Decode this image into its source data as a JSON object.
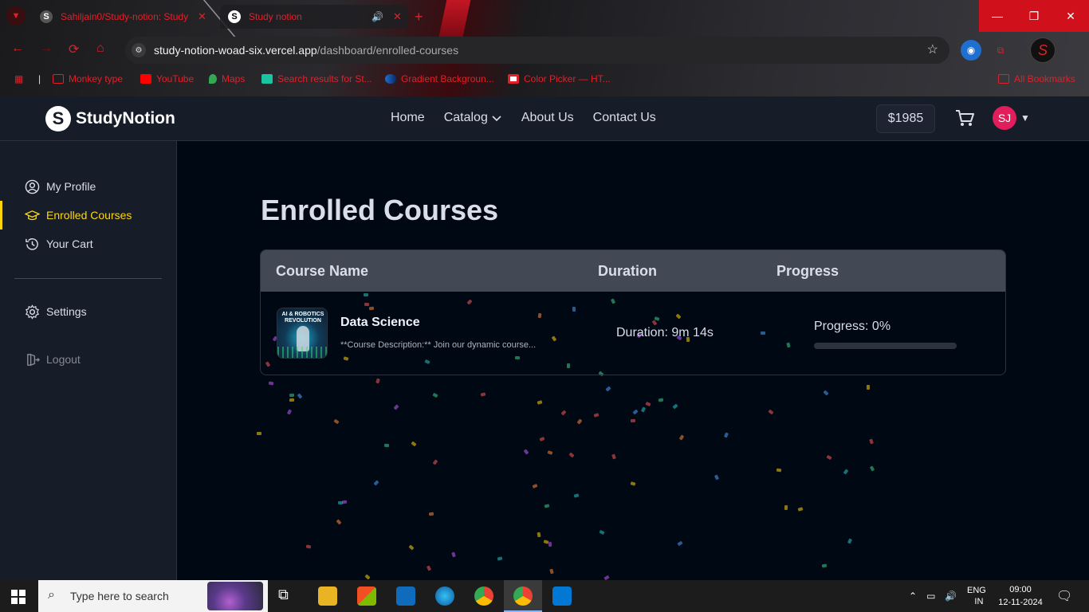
{
  "browser": {
    "tabs": [
      {
        "title": "Sahiljain0/Study-notion: Study N",
        "favicon": "S"
      },
      {
        "title": "Study notion",
        "favicon": "S"
      }
    ],
    "url_host": "study-notion-woad-six.vercel.app",
    "url_path": "/dashboard/enrolled-courses",
    "bookmarks": [
      "Monkey type",
      "YouTube",
      "Maps",
      "Search results for St...",
      "Gradient Backgroun...",
      "Color Picker — HT...",
      "All Bookmarks"
    ],
    "profile_initial": "S"
  },
  "navbar": {
    "brand": "StudyNotion",
    "brand_mark": "S",
    "links": [
      "Home",
      "Catalog",
      "About Us",
      "Contact Us"
    ],
    "balance": "$1985",
    "avatar_initials": "SJ"
  },
  "sidebar": {
    "items": [
      {
        "label": "My Profile",
        "icon": "user-icon"
      },
      {
        "label": "Enrolled Courses",
        "icon": "graduation-cap-icon"
      },
      {
        "label": "Your Cart",
        "icon": "history-icon"
      },
      {
        "label": "Settings",
        "icon": "gear-icon"
      },
      {
        "label": "Logout",
        "icon": "logout-icon"
      }
    ],
    "active_index": 1
  },
  "main": {
    "title": "Enrolled Courses",
    "table": {
      "headers": [
        "Course Name",
        "Duration",
        "Progress"
      ],
      "rows": [
        {
          "thumb_text": "AI & ROBOTICS REVOLUTION",
          "name": "Data Science",
          "description": "**Course Description:** Join our dynamic course...",
          "duration": "Duration: 9m 14s",
          "progress_label": "Progress: 0%",
          "progress": 0
        }
      ]
    }
  },
  "taskbar": {
    "search_placeholder": "Type here to search",
    "lang": "ENG",
    "region": "IN",
    "time": "09:00",
    "date": "12-11-2024"
  },
  "colors": {
    "accent": "#ffd60a",
    "bg": "#000814",
    "panel": "#161d29",
    "avatar": "#e11d5c"
  }
}
